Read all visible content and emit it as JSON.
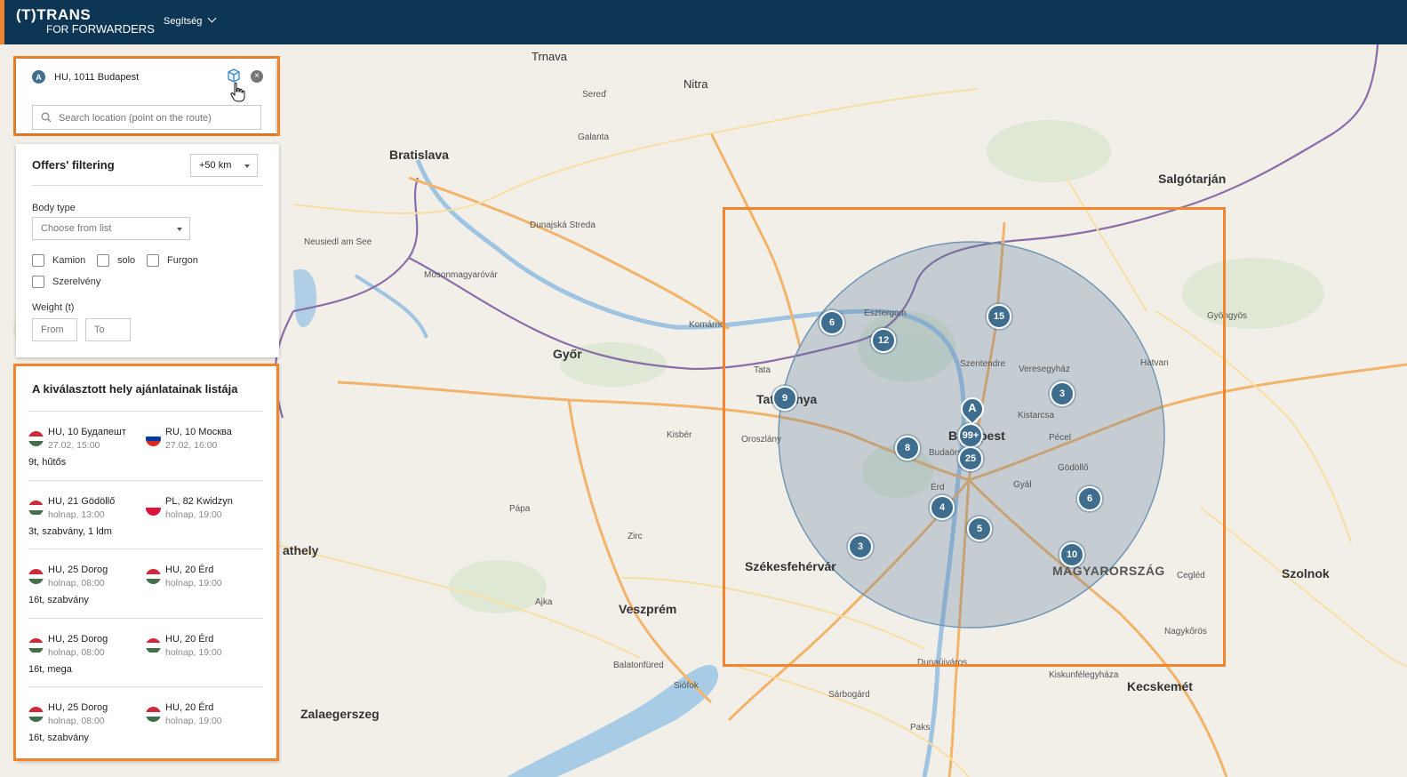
{
  "header": {
    "logo_top": "(T)TRANS",
    "logo_for": "FOR",
    "logo_forwarders": "FORWARDERS",
    "help_label": "Segítség"
  },
  "location_panel": {
    "badge": "A",
    "location": "HU, 1011 Budapest",
    "search_placeholder": "Search location (point on the route)"
  },
  "filter": {
    "title": "Offers' filtering",
    "radius": "+50 km",
    "body_type_label": "Body type",
    "body_type_placeholder": "Choose from list",
    "checkboxes": [
      "Kamion",
      "solo",
      "Furgon",
      "Szerelvény"
    ],
    "weight_label": "Weight (t)",
    "weight_from": "From",
    "weight_to": "To"
  },
  "offers": {
    "title": "A kiválasztott hely ajánlatainak listája",
    "items": [
      {
        "from_place": "HU, 10 Будапешт",
        "from_time": "27.02, 15:00",
        "to_place": "RU, 10 Москва",
        "to_time": "27.02, 16:00",
        "desc": "9t, hűtős",
        "from_flag": "hu",
        "to_flag": "ru"
      },
      {
        "from_place": "HU, 21 Gödöllő",
        "from_time": "holnap, 13:00",
        "to_place": "PL, 82 Kwidzyn",
        "to_time": "holnap, 19:00",
        "desc": "3t, szabvány, 1 ldm",
        "from_flag": "hu",
        "to_flag": "pl"
      },
      {
        "from_place": "HU, 25 Dorog",
        "from_time": "holnap, 08:00",
        "to_place": "HU, 20 Érd",
        "to_time": "holnap, 19:00",
        "desc": "16t, szabvány",
        "from_flag": "hu",
        "to_flag": "hu"
      },
      {
        "from_place": "HU, 25 Dorog",
        "from_time": "holnap, 08:00",
        "to_place": "HU, 20 Érd",
        "to_time": "holnap, 19:00",
        "desc": "16t, mega",
        "from_flag": "hu",
        "to_flag": "hu"
      },
      {
        "from_place": "HU, 25 Dorog",
        "from_time": "holnap, 08:00",
        "to_place": "HU, 20 Érd",
        "to_time": "holnap, 19:00",
        "desc": "16t, szabvány",
        "from_flag": "hu",
        "to_flag": "hu"
      }
    ]
  },
  "map": {
    "marker_label": "A",
    "clusters": [
      "6",
      "12",
      "15",
      "9",
      "3",
      "99+",
      "25",
      "8",
      "4",
      "5",
      "6",
      "3",
      "10"
    ],
    "places": {
      "trnava": "Trnava",
      "nitra": "Nitra",
      "bratislava": "Bratislava",
      "salgotarjan": "Salgótarján",
      "gyor": "Győr",
      "tatabanya": "Tatabánya",
      "budapest": "Budapest",
      "szekesfehervar": "Székesfehérvár",
      "veszprem": "Veszprém",
      "magyarorszag": "MAGYARORSZÁG",
      "szolnok": "Szolnok",
      "kecskemet": "Kecskemét",
      "zalaegerszeg": "Zalaegerszeg",
      "szombathely": "athely",
      "galanta": "Galanta",
      "sered": "Sereď",
      "dunajska": "Dunajská Streda",
      "komarno": "Komárno",
      "esztergom": "Esztergom",
      "szentendre": "Szentendre",
      "godollo": "Gödöllő",
      "erd": "Érd",
      "dunaujvaros": "Dunaújváros",
      "tata": "Tata",
      "oroszlany": "Oroszlány",
      "papa": "Pápa",
      "mosonmagyarovar": "Mosonmagyaróvár",
      "neusiedl": "Neusiedl am See",
      "hatvan": "Hatvan",
      "cegled": "Cegléd",
      "gyongyos": "Gyöngyös",
      "vac": "Veresegyház",
      "pecel": "Pécel",
      "kistarcsa": "Kistarcsa",
      "budaors": "Budaörs",
      "gyal": "Gyál",
      "siofok": "Siófok",
      "balatonfured": "Balatonfüred",
      "ajka": "Ajka",
      "zirc": "Zirc",
      "kisber": "Kisbér",
      "sarbogard": "Sárbogárd",
      "paks": "Paks",
      "nagykoros": "Nagykőrös",
      "kecel": "Kiskunfélegyháza"
    }
  },
  "colors": {
    "header_bg": "#0d3655",
    "accent": "#f0852d",
    "cluster": "#3e6d8e",
    "radius_fill": "rgba(85,120,150,0.28)"
  }
}
